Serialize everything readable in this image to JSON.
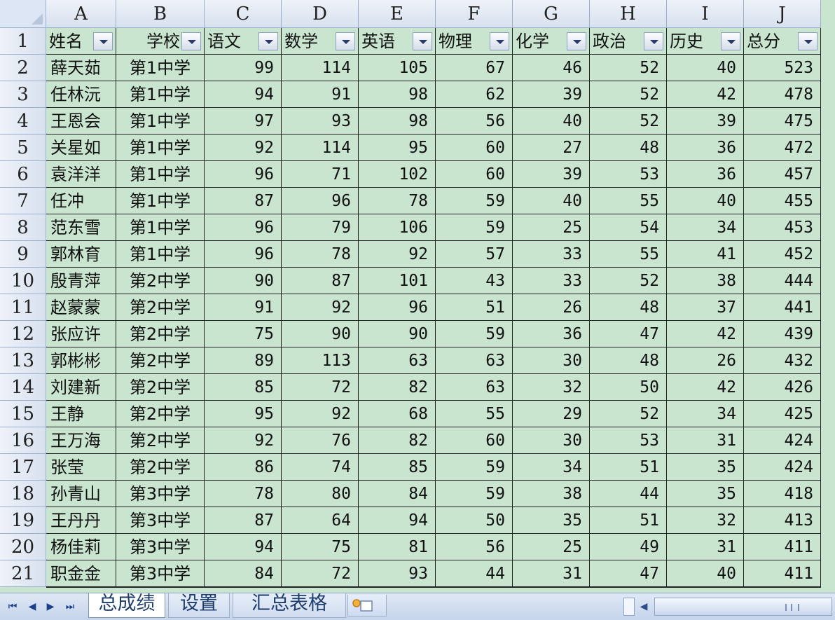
{
  "columns": [
    "A",
    "B",
    "C",
    "D",
    "E",
    "F",
    "G",
    "H",
    "I",
    "J"
  ],
  "row_numbers": [
    "1",
    "2",
    "3",
    "4",
    "5",
    "6",
    "7",
    "8",
    "9",
    "10",
    "11",
    "12",
    "13",
    "14",
    "15",
    "16",
    "17",
    "18",
    "19",
    "20",
    "21"
  ],
  "header": [
    "姓名",
    "学校",
    "语文",
    "数学",
    "英语",
    "物理",
    "化学",
    "政治",
    "历史",
    "总分"
  ],
  "rows": [
    [
      "薛天茹",
      "第1中学",
      "99",
      "114",
      "105",
      "67",
      "46",
      "52",
      "40",
      "523"
    ],
    [
      "任林沅",
      "第1中学",
      "94",
      "91",
      "98",
      "62",
      "39",
      "52",
      "42",
      "478"
    ],
    [
      "王恩会",
      "第1中学",
      "97",
      "93",
      "98",
      "56",
      "40",
      "52",
      "39",
      "475"
    ],
    [
      "关星如",
      "第1中学",
      "92",
      "114",
      "95",
      "60",
      "27",
      "48",
      "36",
      "472"
    ],
    [
      "袁洋洋",
      "第1中学",
      "96",
      "71",
      "102",
      "60",
      "39",
      "53",
      "36",
      "457"
    ],
    [
      "任冲",
      "第1中学",
      "87",
      "96",
      "78",
      "59",
      "40",
      "55",
      "40",
      "455"
    ],
    [
      "范东雪",
      "第1中学",
      "96",
      "79",
      "106",
      "59",
      "25",
      "54",
      "34",
      "453"
    ],
    [
      "郭林育",
      "第1中学",
      "96",
      "78",
      "92",
      "57",
      "33",
      "55",
      "41",
      "452"
    ],
    [
      "殷青萍",
      "第2中学",
      "90",
      "87",
      "101",
      "43",
      "33",
      "52",
      "38",
      "444"
    ],
    [
      "赵蒙蒙",
      "第2中学",
      "91",
      "92",
      "96",
      "51",
      "26",
      "48",
      "37",
      "441"
    ],
    [
      "张应许",
      "第2中学",
      "75",
      "90",
      "90",
      "59",
      "36",
      "47",
      "42",
      "439"
    ],
    [
      "郭彬彬",
      "第2中学",
      "89",
      "113",
      "63",
      "63",
      "30",
      "48",
      "26",
      "432"
    ],
    [
      "刘建新",
      "第2中学",
      "85",
      "72",
      "82",
      "63",
      "32",
      "50",
      "42",
      "426"
    ],
    [
      "王静",
      "第2中学",
      "95",
      "92",
      "68",
      "55",
      "29",
      "52",
      "34",
      "425"
    ],
    [
      "王万海",
      "第2中学",
      "92",
      "76",
      "82",
      "60",
      "30",
      "53",
      "31",
      "424"
    ],
    [
      "张莹",
      "第2中学",
      "86",
      "74",
      "85",
      "59",
      "34",
      "51",
      "35",
      "424"
    ],
    [
      "孙青山",
      "第3中学",
      "78",
      "80",
      "84",
      "59",
      "38",
      "44",
      "35",
      "418"
    ],
    [
      "王丹丹",
      "第3中学",
      "87",
      "64",
      "94",
      "50",
      "35",
      "51",
      "32",
      "413"
    ],
    [
      "杨佳莉",
      "第3中学",
      "94",
      "75",
      "81",
      "56",
      "25",
      "49",
      "31",
      "411"
    ],
    [
      "职金金",
      "第3中学",
      "84",
      "72",
      "93",
      "44",
      "31",
      "47",
      "40",
      "411"
    ]
  ],
  "sheet_tabs": [
    "总成绩",
    "设置",
    "汇总表格"
  ],
  "nav_icons": [
    "first-sheet-icon",
    "prev-sheet-icon",
    "next-sheet-icon",
    "last-sheet-icon",
    "insert-sheet-icon"
  ],
  "colors": {
    "cell_bg": "#c9e5d0",
    "header_bg": "#dde6f4",
    "grid": "#222222"
  }
}
